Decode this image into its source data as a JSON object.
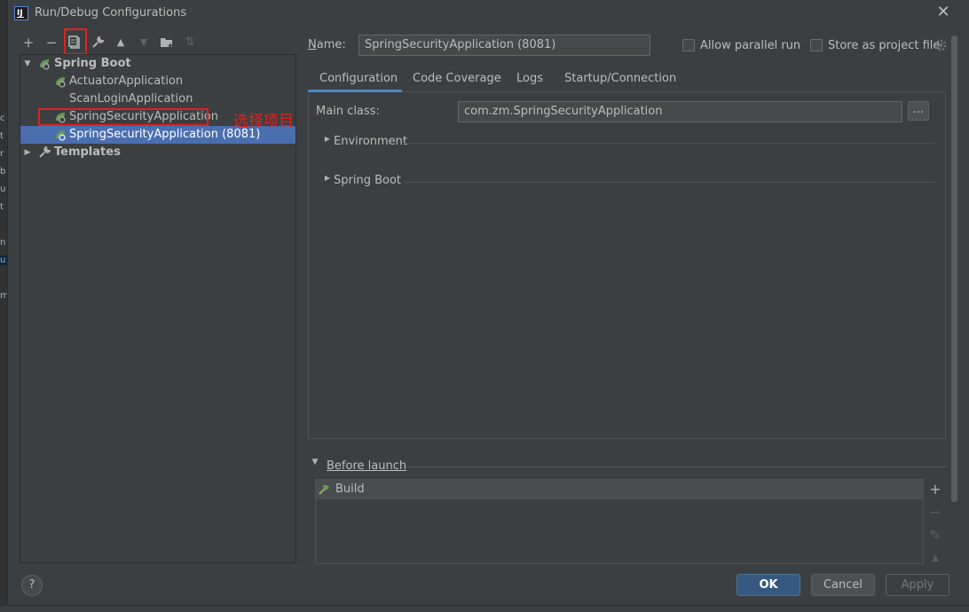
{
  "window": {
    "title": "Run/Debug Configurations",
    "close": "✕"
  },
  "toolbar": {
    "add": "+",
    "remove": "−",
    "copy": "⧉",
    "edit": "🔧",
    "up": "▲",
    "down": "▼",
    "folder": "▣",
    "sort": "⇅"
  },
  "tree": {
    "root_label": "Spring Boot",
    "items": [
      {
        "label": "ActuatorApplication"
      },
      {
        "label": "ScanLoginApplication"
      },
      {
        "label": "SpringSecurityApplication"
      },
      {
        "label": "SpringSecurityApplication (8081)"
      }
    ],
    "templates_label": "Templates"
  },
  "annotation": "选择项目",
  "form": {
    "name_label": "Name:",
    "name_value": "SpringSecurityApplication (8081)",
    "allow_parallel_label": "Allow parallel run",
    "store_project_label": "Store as project file"
  },
  "tabs": [
    "Configuration",
    "Code Coverage",
    "Logs",
    "Startup/Connection"
  ],
  "config": {
    "main_class_label": "Main class:",
    "main_class_value": "com.zm.SpringSecurityApplication",
    "browse": "...",
    "environment_label": "Environment",
    "spring_boot_label": "Spring Boot"
  },
  "before_launch": {
    "label": "Before launch",
    "items": [
      {
        "label": "Build"
      }
    ],
    "add": "+",
    "remove": "−",
    "edit": "✎",
    "up": "▲"
  },
  "buttons": {
    "ok": "OK",
    "cancel": "Cancel",
    "apply": "Apply",
    "help": "?"
  },
  "colors": {
    "selection": "#4b6eaf",
    "annotation": "#e0221c",
    "accent": "#4a88c7",
    "ok_button": "#365880"
  }
}
